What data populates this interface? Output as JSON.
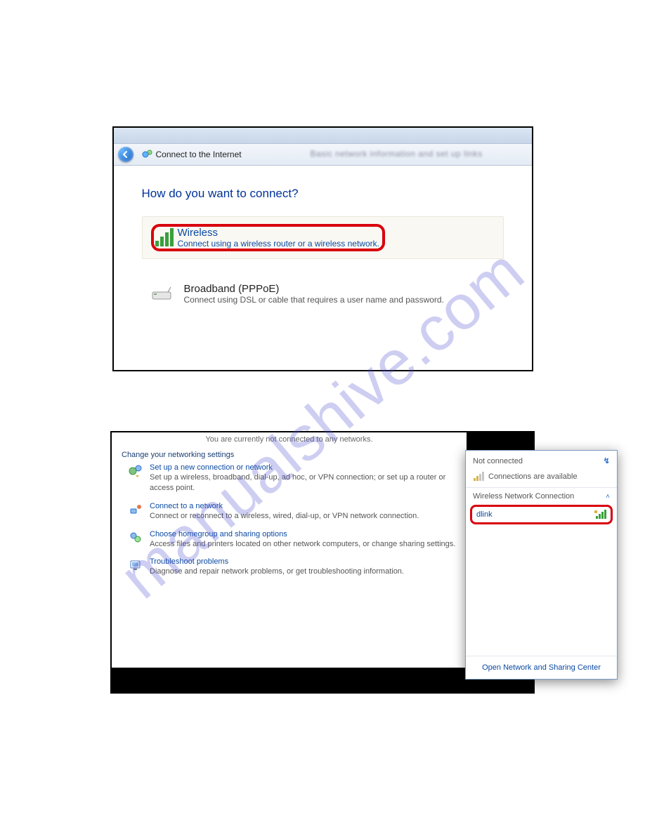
{
  "watermark": "manualshive.com",
  "shot1": {
    "titlebar_blur": "Basic network information and set up links",
    "window_title": "Connect to the Internet",
    "heading": "How do you want to connect?",
    "option_wireless": {
      "title": "Wireless",
      "sub": "Connect using a wireless router or a wireless network."
    },
    "option_broadband": {
      "title": "Broadband (PPPoE)",
      "sub": "Connect using DSL or cable that requires a user name and password."
    }
  },
  "shot2": {
    "top_status": "You are currently not connected to any networks.",
    "section_title": "Change your networking settings",
    "items": [
      {
        "link": "Set up a new connection or network",
        "desc": "Set up a wireless, broadband, dial-up, ad hoc, or VPN connection; or set up a router or access point."
      },
      {
        "link": "Connect to a network",
        "desc": "Connect or reconnect to a wireless, wired, dial-up, or VPN network connection."
      },
      {
        "link": "Choose homegroup and sharing options",
        "desc": "Access files and printers located on other network computers, or change sharing settings."
      },
      {
        "link": "Troubleshoot problems",
        "desc": "Diagnose and repair network problems, or get troubleshooting information."
      }
    ],
    "flyout": {
      "not_connected": "Not connected",
      "avail": "Connections are available",
      "section": "Wireless Network Connection",
      "network_name": "dlink",
      "footer_link": "Open Network and Sharing Center"
    }
  }
}
